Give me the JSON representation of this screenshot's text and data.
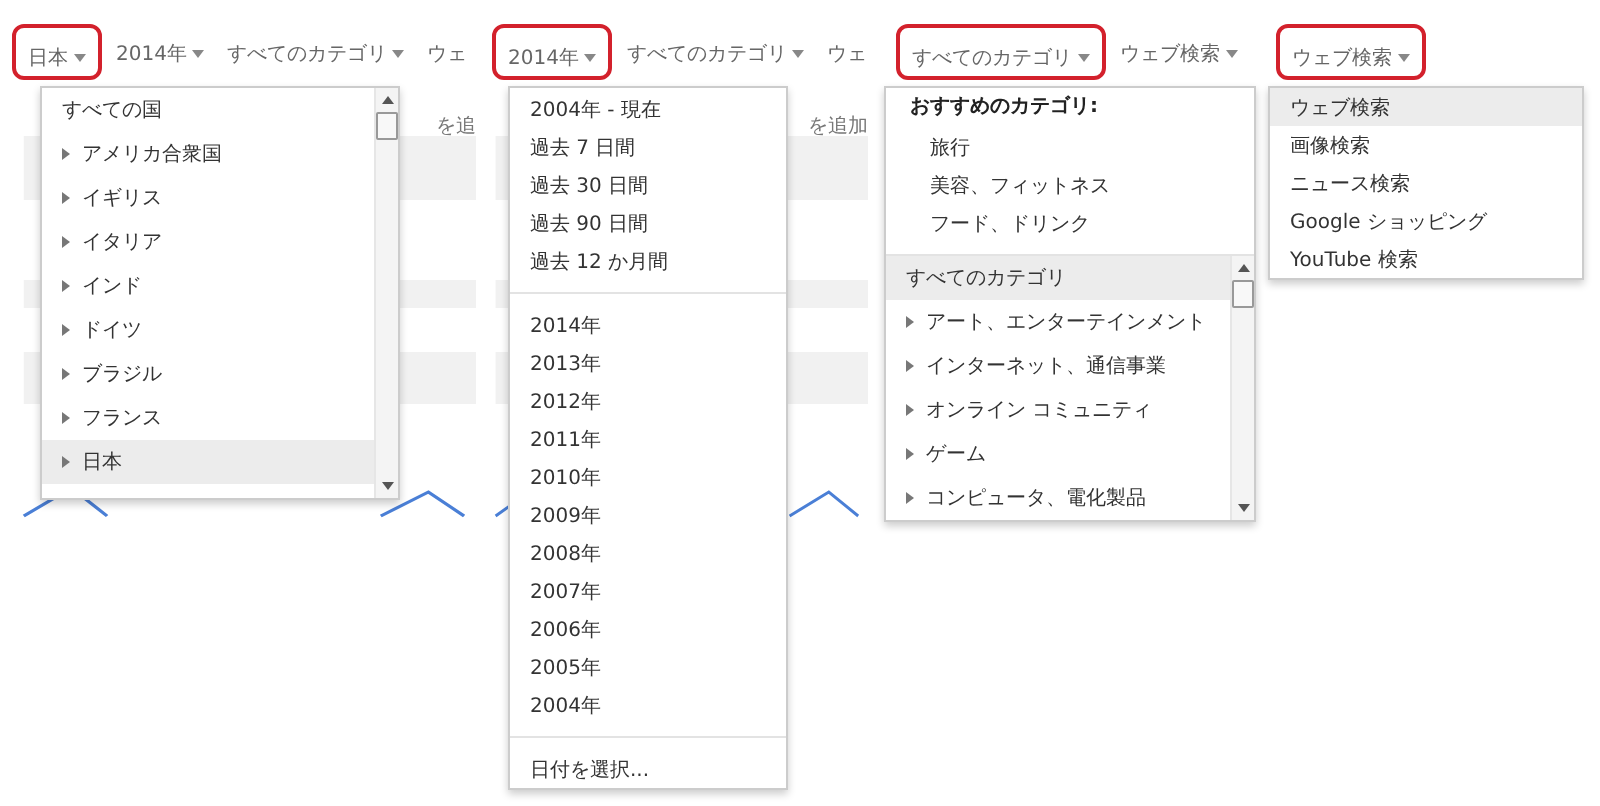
{
  "panels": [
    {
      "toolbar": [
        {
          "label": "日本",
          "highlighted": true,
          "caret": true
        },
        {
          "label": "2014年",
          "highlighted": false,
          "caret": true
        },
        {
          "label": "すべてのカテゴリ",
          "highlighted": false,
          "caret": true
        },
        {
          "label": "ウェ",
          "highlighted": false,
          "caret": false
        }
      ],
      "behind_text": "を追",
      "menu": {
        "sections": [
          {
            "scrollbar": true,
            "items": [
              {
                "label": "すべての国",
                "expandable": false,
                "selected": false
              },
              {
                "label": "アメリカ合衆国",
                "expandable": true,
                "selected": false
              },
              {
                "label": "イギリス",
                "expandable": true,
                "selected": false
              },
              {
                "label": "イタリア",
                "expandable": true,
                "selected": false
              },
              {
                "label": "インド",
                "expandable": true,
                "selected": false
              },
              {
                "label": "ドイツ",
                "expandable": true,
                "selected": false
              },
              {
                "label": "ブラジル",
                "expandable": true,
                "selected": false
              },
              {
                "label": "フランス",
                "expandable": true,
                "selected": false
              },
              {
                "label": "日本",
                "expandable": true,
                "selected": true
              }
            ]
          }
        ]
      }
    },
    {
      "toolbar": [
        {
          "label": "2014年",
          "highlighted": true,
          "caret": true
        },
        {
          "label": "すべてのカテゴリ",
          "highlighted": false,
          "caret": true
        },
        {
          "label": "ウェ",
          "highlighted": false,
          "caret": false
        }
      ],
      "behind_text": "を追加",
      "menu": {
        "sections": [
          {
            "items": [
              {
                "label": "2004年 - 現在",
                "expandable": false,
                "selected": false
              },
              {
                "label": "過去 7 日間",
                "expandable": false,
                "selected": false
              },
              {
                "label": "過去 30 日間",
                "expandable": false,
                "selected": false
              },
              {
                "label": "過去 90 日間",
                "expandable": false,
                "selected": false
              },
              {
                "label": "過去 12 か月間",
                "expandable": false,
                "selected": false
              }
            ]
          },
          {
            "items": [
              {
                "label": "2014年",
                "expandable": false,
                "selected": false
              },
              {
                "label": "2013年",
                "expandable": false,
                "selected": false
              },
              {
                "label": "2012年",
                "expandable": false,
                "selected": false
              },
              {
                "label": "2011年",
                "expandable": false,
                "selected": false
              },
              {
                "label": "2010年",
                "expandable": false,
                "selected": false
              },
              {
                "label": "2009年",
                "expandable": false,
                "selected": false
              },
              {
                "label": "2008年",
                "expandable": false,
                "selected": false
              },
              {
                "label": "2007年",
                "expandable": false,
                "selected": false
              },
              {
                "label": "2006年",
                "expandable": false,
                "selected": false
              },
              {
                "label": "2005年",
                "expandable": false,
                "selected": false
              },
              {
                "label": "2004年",
                "expandable": false,
                "selected": false
              }
            ]
          },
          {
            "items": [
              {
                "label": "日付を選択...",
                "expandable": false,
                "selected": false
              }
            ]
          }
        ]
      }
    },
    {
      "toolbar": [
        {
          "label": "すべてのカテゴリ",
          "highlighted": true,
          "caret": true
        },
        {
          "label": "ウェブ検索",
          "highlighted": false,
          "caret": true
        }
      ],
      "menu": {
        "sections": [
          {
            "heading": "おすすめのカテゴリ:",
            "items": [
              {
                "label": "旅行",
                "expandable": false,
                "selected": false
              },
              {
                "label": "美容、フィットネス",
                "expandable": false,
                "selected": false
              },
              {
                "label": "フード、ドリンク",
                "expandable": false,
                "selected": false
              }
            ]
          },
          {
            "scrollbar": true,
            "items": [
              {
                "label": "すべてのカテゴリ",
                "expandable": false,
                "selected": true
              },
              {
                "label": "アート、エンターテインメント",
                "expandable": true,
                "selected": false
              },
              {
                "label": "インターネット、通信事業",
                "expandable": true,
                "selected": false
              },
              {
                "label": "オンライン コミュニティ",
                "expandable": true,
                "selected": false
              },
              {
                "label": "ゲーム",
                "expandable": true,
                "selected": false
              },
              {
                "label": "コンピュータ、電化製品",
                "expandable": true,
                "selected": false
              }
            ]
          }
        ]
      }
    },
    {
      "toolbar": [
        {
          "label": "ウェブ検索",
          "highlighted": true,
          "caret": true
        }
      ],
      "menu": {
        "sections": [
          {
            "items": [
              {
                "label": "ウェブ検索",
                "expandable": false,
                "selected": true
              },
              {
                "label": "画像検索",
                "expandable": false,
                "selected": false
              },
              {
                "label": "ニュース検索",
                "expandable": false,
                "selected": false
              },
              {
                "label": "Google ショッピング",
                "expandable": false,
                "selected": false
              },
              {
                "label": "YouTube 検索",
                "expandable": false,
                "selected": false
              }
            ]
          }
        ]
      }
    }
  ]
}
